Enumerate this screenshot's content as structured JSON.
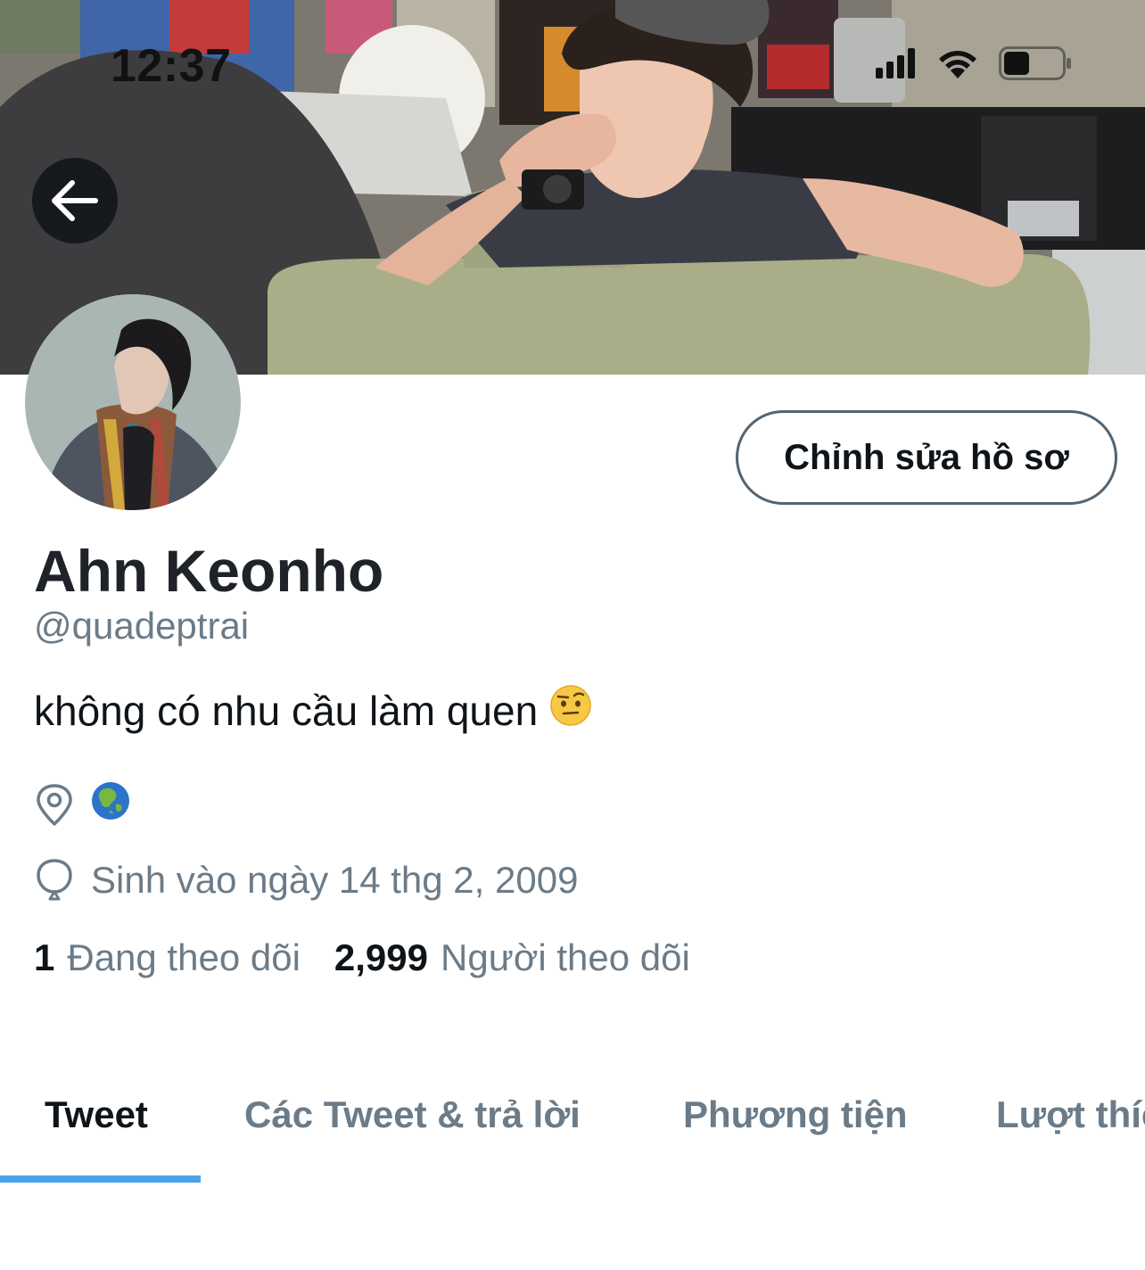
{
  "status_bar": {
    "time": "12:37",
    "icons": [
      "cellular-signal-icon",
      "wifi-icon",
      "battery-icon"
    ]
  },
  "header": {
    "back_icon": "arrow-left-icon",
    "edit_profile_label": "Chỉnh sửa hồ sơ"
  },
  "profile": {
    "display_name": "Ahn Keonho",
    "handle": "@quadeptrai",
    "bio": "không có nhu cầu làm quen",
    "bio_emoji": "🤨",
    "location_icon": "location-pin-icon",
    "location": "🌏",
    "birth_icon": "balloon-icon",
    "birth": "Sinh vào ngày 14 thg 2, 2009",
    "following_count": "1",
    "following_label": "Đang theo dõi",
    "followers_count": "2,999",
    "followers_label": "Người theo dõi"
  },
  "tabs": [
    {
      "label": "Tweet",
      "active": true
    },
    {
      "label": "Các Tweet & trả lời",
      "active": false
    },
    {
      "label": "Phương tiện",
      "active": false
    },
    {
      "label": "Lượt thích",
      "active": false
    }
  ],
  "colors": {
    "accent": "#4aa3ea",
    "secondary_text": "#6b7b88",
    "primary_text": "#0f1419"
  }
}
